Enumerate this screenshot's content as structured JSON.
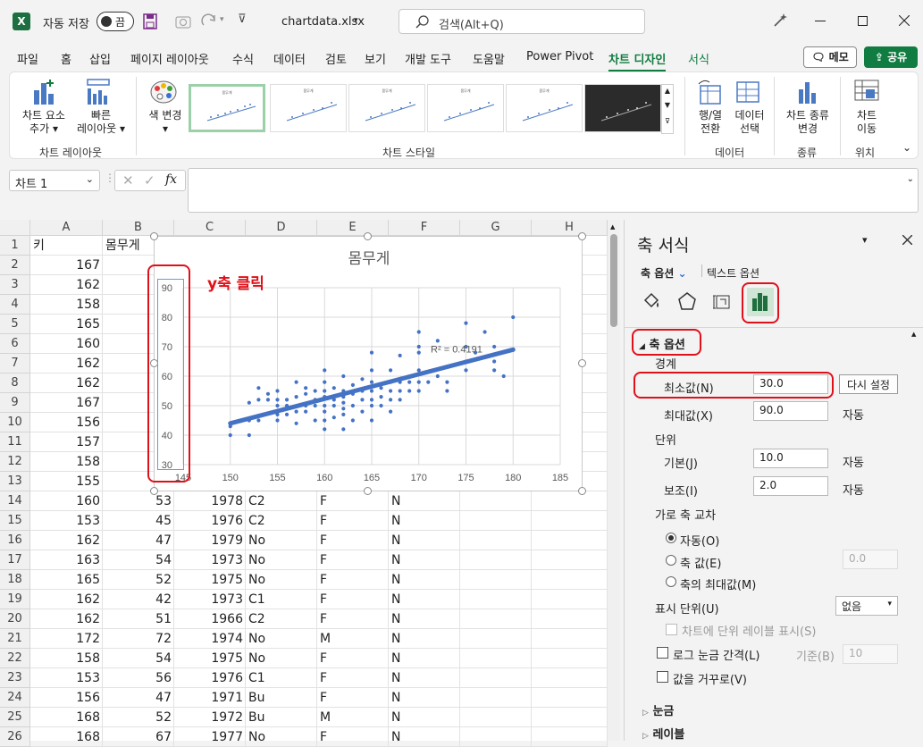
{
  "titlebar": {
    "autosave_label": "자동 저장",
    "autosave_state": "끔",
    "filename": "chartdata.xlsx",
    "search_placeholder": "검색(Alt+Q)"
  },
  "menu": {
    "items": [
      "파일",
      "홈",
      "삽입",
      "페이지 레이아웃",
      "수식",
      "데이터",
      "검토",
      "보기",
      "개발 도구",
      "도움말",
      "Power Pivot",
      "차트 디자인",
      "서식"
    ],
    "active": "차트 디자인",
    "memo": "메모",
    "share": "공유"
  },
  "ribbon": {
    "add_element": [
      "차트 요소",
      "추가"
    ],
    "quick_layout": [
      "빠른",
      "레이아웃"
    ],
    "change_color": "색 변경",
    "switch_row_col": [
      "행/열",
      "전환"
    ],
    "select_data": [
      "데이터",
      "선택"
    ],
    "change_type": [
      "차트 종류",
      "변경"
    ],
    "move_chart": [
      "차트",
      "이동"
    ],
    "groups": {
      "layout": "차트 레이아웃",
      "styles": "차트 스타일",
      "data": "데이터",
      "type": "종류",
      "location": "위치"
    },
    "thumb_title": "몸무게"
  },
  "formula_bar": {
    "name_box": "차트 1",
    "fx": "fx"
  },
  "grid": {
    "columns": [
      "A",
      "B",
      "C",
      "D",
      "E",
      "F",
      "G",
      "H"
    ],
    "row_numbers": [
      1,
      2,
      3,
      4,
      5,
      6,
      7,
      8,
      9,
      10,
      11,
      12,
      13,
      14,
      15,
      16,
      17,
      18,
      19,
      20,
      21,
      22,
      23,
      24,
      25,
      26
    ],
    "header_row": [
      "키",
      "몸무게"
    ],
    "a_col_rows_2_13": [
      "167",
      "162",
      "158",
      "165",
      "160",
      "162",
      "162",
      "167",
      "156",
      "157",
      "158",
      "155"
    ],
    "rows_14_26": [
      [
        "160",
        "53",
        "1978",
        "C2",
        "F",
        "N"
      ],
      [
        "153",
        "45",
        "1976",
        "C2",
        "F",
        "N"
      ],
      [
        "162",
        "47",
        "1979",
        "No",
        "F",
        "N"
      ],
      [
        "163",
        "54",
        "1973",
        "No",
        "F",
        "N"
      ],
      [
        "165",
        "52",
        "1975",
        "No",
        "F",
        "N"
      ],
      [
        "162",
        "42",
        "1973",
        "C1",
        "F",
        "N"
      ],
      [
        "162",
        "51",
        "1966",
        "C2",
        "F",
        "N"
      ],
      [
        "172",
        "72",
        "1974",
        "No",
        "M",
        "N"
      ],
      [
        "158",
        "54",
        "1975",
        "No",
        "F",
        "N"
      ],
      [
        "153",
        "56",
        "1976",
        "C1",
        "F",
        "N"
      ],
      [
        "156",
        "47",
        "1971",
        "Bu",
        "F",
        "N"
      ],
      [
        "168",
        "52",
        "1972",
        "Bu",
        "M",
        "N"
      ],
      [
        "168",
        "67",
        "1977",
        "No",
        "F",
        "N"
      ]
    ]
  },
  "chart_data": {
    "type": "scatter",
    "title": "몸무게",
    "xlim": [
      145,
      185
    ],
    "ylim": [
      30,
      90
    ],
    "xticks": [
      "145",
      "150",
      "155",
      "160",
      "165",
      "170",
      "175",
      "180",
      "185"
    ],
    "yticks": [
      "30",
      "40",
      "50",
      "60",
      "70",
      "80",
      "90"
    ],
    "r2_label": "R² = 0.4191",
    "trendline": {
      "from": [
        150,
        44
      ],
      "to": [
        180,
        69
      ]
    },
    "points": [
      [
        150,
        40
      ],
      [
        150,
        43
      ],
      [
        150,
        44
      ],
      [
        152,
        40
      ],
      [
        152,
        45
      ],
      [
        152,
        51
      ],
      [
        153,
        45
      ],
      [
        153,
        52
      ],
      [
        153,
        56
      ],
      [
        154,
        52
      ],
      [
        154,
        54
      ],
      [
        155,
        45
      ],
      [
        155,
        47
      ],
      [
        155,
        50
      ],
      [
        155,
        52
      ],
      [
        155,
        55
      ],
      [
        156,
        47
      ],
      [
        156,
        50
      ],
      [
        156,
        52
      ],
      [
        157,
        44
      ],
      [
        157,
        48
      ],
      [
        157,
        53
      ],
      [
        157,
        58
      ],
      [
        158,
        48
      ],
      [
        158,
        50
      ],
      [
        158,
        54
      ],
      [
        158,
        56
      ],
      [
        159,
        45
      ],
      [
        159,
        50
      ],
      [
        159,
        52
      ],
      [
        159,
        55
      ],
      [
        160,
        42
      ],
      [
        160,
        45
      ],
      [
        160,
        48
      ],
      [
        160,
        50
      ],
      [
        160,
        53
      ],
      [
        160,
        55
      ],
      [
        160,
        58
      ],
      [
        160,
        62
      ],
      [
        161,
        46
      ],
      [
        161,
        50
      ],
      [
        161,
        52
      ],
      [
        161,
        56
      ],
      [
        162,
        42
      ],
      [
        162,
        47
      ],
      [
        162,
        49
      ],
      [
        162,
        51
      ],
      [
        162,
        53
      ],
      [
        162,
        55
      ],
      [
        162,
        60
      ],
      [
        163,
        45
      ],
      [
        163,
        50
      ],
      [
        163,
        54
      ],
      [
        163,
        57
      ],
      [
        164,
        48
      ],
      [
        164,
        52
      ],
      [
        164,
        55
      ],
      [
        164,
        59
      ],
      [
        165,
        45
      ],
      [
        165,
        50
      ],
      [
        165,
        52
      ],
      [
        165,
        55
      ],
      [
        165,
        58
      ],
      [
        165,
        62
      ],
      [
        165,
        68
      ],
      [
        166,
        50
      ],
      [
        166,
        53
      ],
      [
        166,
        56
      ],
      [
        167,
        48
      ],
      [
        167,
        52
      ],
      [
        167,
        55
      ],
      [
        167,
        58
      ],
      [
        167,
        62
      ],
      [
        168,
        52
      ],
      [
        168,
        55
      ],
      [
        168,
        58
      ],
      [
        168,
        67
      ],
      [
        169,
        55
      ],
      [
        169,
        58
      ],
      [
        170,
        55
      ],
      [
        170,
        58
      ],
      [
        170,
        62
      ],
      [
        170,
        68
      ],
      [
        170,
        70
      ],
      [
        170,
        75
      ],
      [
        171,
        58
      ],
      [
        172,
        60
      ],
      [
        172,
        72
      ],
      [
        173,
        55
      ],
      [
        173,
        58
      ],
      [
        175,
        62
      ],
      [
        175,
        65
      ],
      [
        175,
        70
      ],
      [
        175,
        78
      ],
      [
        176,
        68
      ],
      [
        177,
        75
      ],
      [
        178,
        62
      ],
      [
        178,
        65
      ],
      [
        178,
        70
      ],
      [
        179,
        60
      ],
      [
        180,
        80
      ]
    ]
  },
  "annotations": {
    "y_axis_click": "y축 클릭"
  },
  "pane": {
    "title": "축 서식",
    "tab_axis_options": "축 옵션",
    "tab_text_options": "텍스트 옵션",
    "section_axis_options": "축 옵션",
    "bounds": "경계",
    "min_label": "최소값(N)",
    "min_value": "30.0",
    "reset": "다시 설정",
    "max_label": "최대값(X)",
    "max_value": "90.0",
    "auto": "자동",
    "units": "단위",
    "major_label": "기본(J)",
    "major_value": "10.0",
    "minor_label": "보조(I)",
    "minor_value": "2.0",
    "horizontal_axis_crosses": "가로 축 교차",
    "radio_auto": "자동(O)",
    "radio_axis_value": "축 값(E)",
    "axis_value_input": "0.0",
    "radio_max": "축의 최대값(M)",
    "display_units_label": "표시 단위(U)",
    "display_units_value": "없음",
    "show_units_label": "차트에 단위 레이블 표시(S)",
    "log_scale": "로그 눈금 간격(L)",
    "base_label": "기준(B)",
    "base_value": "10",
    "values_reverse": "값을 거꾸로(V)",
    "tick_marks": "눈금",
    "labels": "레이블"
  }
}
